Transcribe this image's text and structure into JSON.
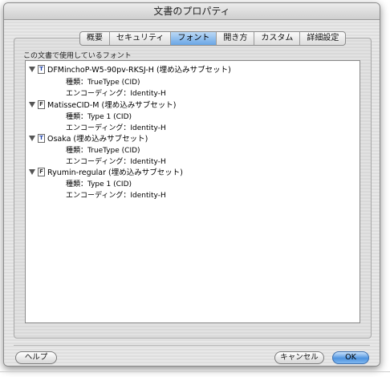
{
  "window": {
    "title": "文書のプロパティ"
  },
  "tabs": [
    {
      "label": "概要",
      "active": false
    },
    {
      "label": "セキュリティ",
      "active": false
    },
    {
      "label": "フォント",
      "active": true
    },
    {
      "label": "開き方",
      "active": false
    },
    {
      "label": "カスタム",
      "active": false
    },
    {
      "label": "詳細設定",
      "active": false
    }
  ],
  "fonts_section": {
    "label": "この文書で使用しているフォント",
    "items": [
      {
        "icon": "truetype-font-icon",
        "name": "DFMinchoP-W5-90pv-RKSJ-H (埋め込みサブセット)",
        "type": "種類：TrueType (CID)",
        "encoding": "エンコーディング：Identity-H"
      },
      {
        "icon": "type1-font-icon",
        "name": "MatisseCID-M (埋め込みサブセット)",
        "type": "種類：Type 1 (CID)",
        "encoding": "エンコーディング：Identity-H"
      },
      {
        "icon": "truetype-font-icon",
        "name": "Osaka (埋め込みサブセット)",
        "type": "種類：TrueType (CID)",
        "encoding": "エンコーディング：Identity-H"
      },
      {
        "icon": "type1-font-icon",
        "name": "Ryumin-regular (埋め込みサブセット)",
        "type": "種類：Type 1 (CID)",
        "encoding": "エンコーディング：Identity-H"
      }
    ]
  },
  "buttons": {
    "help": "ヘルプ",
    "cancel": "キャンセル",
    "ok": "OK"
  },
  "colors": {
    "active_tab": "#6aa6e6",
    "primary_button": "#4f94e0"
  }
}
